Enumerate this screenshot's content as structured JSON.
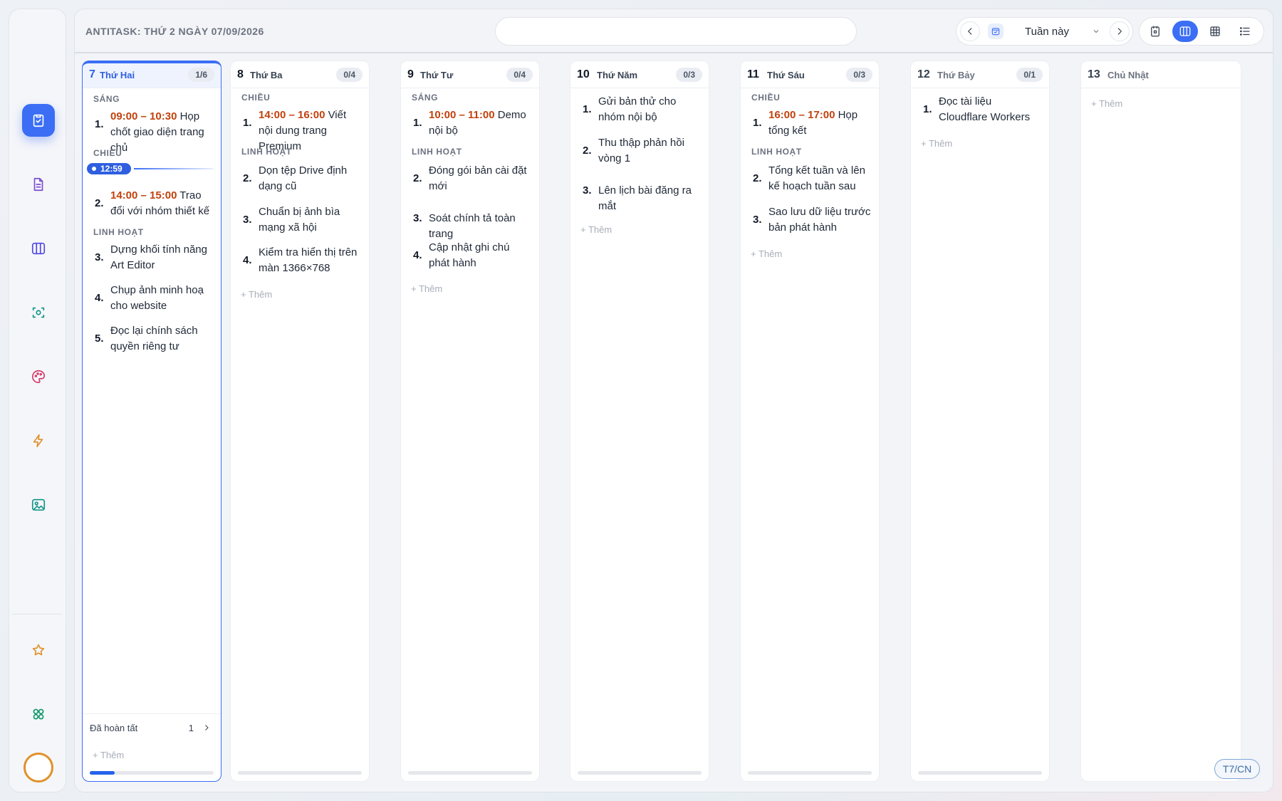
{
  "app": {
    "title": "ANTITASK: THỨ 2 NGÀY 07/09/2026"
  },
  "search": {
    "value": "",
    "placeholder": ""
  },
  "nav": {
    "period_label": "Tuần này"
  },
  "sidebar": {
    "items": [
      {
        "name": "tasks",
        "icon": "clipboard-check-icon",
        "color": "#3b6ef5",
        "active": true
      },
      {
        "name": "notes",
        "icon": "document-icon",
        "color": "#7c4dce"
      },
      {
        "name": "board",
        "icon": "columns-icon",
        "color": "#4f46e5"
      },
      {
        "name": "capture",
        "icon": "scan-icon",
        "color": "#0f9488"
      },
      {
        "name": "palette",
        "icon": "palette-icon",
        "color": "#d63a6b"
      },
      {
        "name": "energy",
        "icon": "lightning-icon",
        "color": "#e0912b"
      },
      {
        "name": "gallery",
        "icon": "image-icon",
        "color": "#0f9488"
      },
      {
        "name": "favorites",
        "icon": "star-icon",
        "color": "#e0912b"
      },
      {
        "name": "apps",
        "icon": "grid-icon",
        "color": "#12966a"
      }
    ]
  },
  "columns": [
    {
      "num": "7",
      "name": "Thứ Hai",
      "count": "1/6",
      "sections": [
        {
          "label": "SÁNG",
          "tasks": [
            {
              "n": "1.",
              "time": "09:00 – 10:30",
              "text": " Họp chốt giao diện trang chủ"
            }
          ]
        },
        {
          "label": "CHIỀU",
          "tasks": [
            {
              "n": "2.",
              "time": "14:00 – 15:00",
              "text": " Trao đổi với nhóm thiết kế"
            }
          ]
        },
        {
          "label": "LINH HOẠT",
          "tasks": [
            {
              "n": "3.",
              "text": "Dựng khối tính năng Art Editor"
            },
            {
              "n": "4.",
              "text": "Chụp ảnh minh hoạ cho website"
            },
            {
              "n": "5.",
              "text": "Đọc lại chính sách quyền riêng tư"
            }
          ]
        }
      ],
      "now_label": "12:59",
      "done_label": "Đã hoàn tất",
      "done_count": "1",
      "add_label": "+ Thêm"
    },
    {
      "num": "8",
      "name": "Thứ Ba",
      "count": "0/4",
      "sections": [
        {
          "label": "CHIỀU",
          "tasks": [
            {
              "n": "1.",
              "time": "14:00 – 16:00",
              "text": " Viết nội dung trang Premium"
            }
          ]
        },
        {
          "label": "LINH HOẠT",
          "tasks": [
            {
              "n": "2.",
              "text": "Dọn tệp Drive định dạng cũ"
            },
            {
              "n": "3.",
              "text": "Chuẩn bị ảnh bìa mạng xã hội"
            },
            {
              "n": "4.",
              "text": "Kiểm tra hiển thị trên màn 1366×768"
            }
          ]
        }
      ],
      "add_label": "+ Thêm"
    },
    {
      "num": "9",
      "name": "Thứ Tư",
      "count": "0/4",
      "sections": [
        {
          "label": "SÁNG",
          "tasks": [
            {
              "n": "1.",
              "time": "10:00 – 11:00",
              "text": " Demo nội bộ"
            }
          ]
        },
        {
          "label": "LINH HOẠT",
          "tasks": [
            {
              "n": "2.",
              "text": "Đóng gói bản cài đặt mới"
            },
            {
              "n": "3.",
              "text": "Soát chính tả toàn trang"
            },
            {
              "n": "4.",
              "text": "Cập nhật ghi chú phát hành"
            }
          ]
        }
      ],
      "add_label": "+ Thêm"
    },
    {
      "num": "10",
      "name": "Thứ Năm",
      "count": "0/3",
      "sections": [
        {
          "label": "",
          "tasks": [
            {
              "n": "1.",
              "text": "Gửi bản thử cho nhóm nội bộ"
            },
            {
              "n": "2.",
              "text": "Thu thập phản hồi vòng 1"
            },
            {
              "n": "3.",
              "text": "Lên lịch bài đăng ra mắt"
            }
          ]
        }
      ],
      "add_label": "+ Thêm"
    },
    {
      "num": "11",
      "name": "Thứ Sáu",
      "count": "0/3",
      "sections": [
        {
          "label": "CHIỀU",
          "tasks": [
            {
              "n": "1.",
              "time": "16:00 – 17:00",
              "text": " Họp tổng kết"
            }
          ]
        },
        {
          "label": "LINH HOẠT",
          "tasks": [
            {
              "n": "2.",
              "text": "Tổng kết tuần và lên kế hoạch tuần sau"
            },
            {
              "n": "3.",
              "text": "Sao lưu dữ liệu trước bản phát hành"
            }
          ]
        }
      ],
      "add_label": "+ Thêm"
    },
    {
      "num": "12",
      "name": "Thứ Bảy",
      "count": "0/1",
      "sections": [
        {
          "label": "",
          "tasks": [
            {
              "n": "1.",
              "text": "Đọc tài liệu Cloudflare Workers"
            }
          ]
        }
      ],
      "add_label": "+ Thêm"
    },
    {
      "num": "13",
      "name": "Chủ Nhật",
      "sections": [],
      "add_label": "+ Thêm"
    }
  ],
  "weekend_toggle": "T7/CN",
  "colors": {
    "accent": "#3b6ef5",
    "time": "#c2410c"
  }
}
